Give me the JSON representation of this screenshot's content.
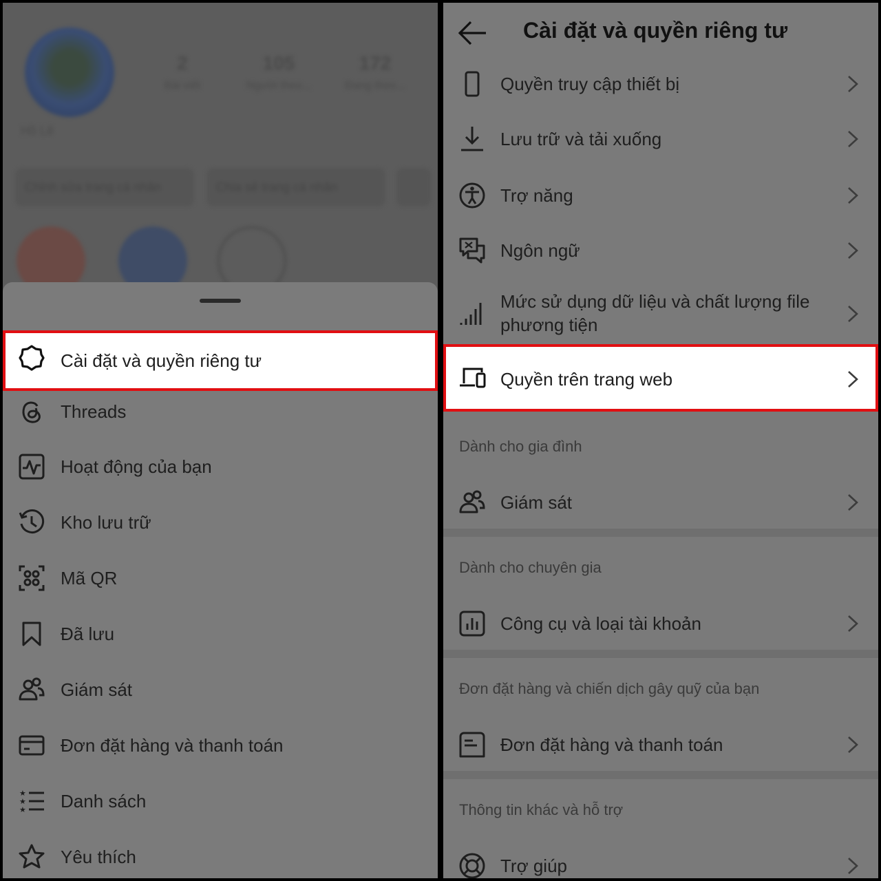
{
  "left_panel": {
    "profile_backdrop": {
      "stats": [
        {
          "num": "2",
          "label": "Bài viết"
        },
        {
          "num": "105",
          "label": "Người theo..."
        },
        {
          "num": "172",
          "label": "Đang theo..."
        }
      ],
      "name": "Hồ Lê",
      "buttons": [
        "Chỉnh sửa trang cá nhân",
        "Chia sẻ trang cá nhân"
      ]
    },
    "menu": [
      {
        "label": "Cài đặt và quyền riêng tư",
        "icon": "settings-gear-icon",
        "highlighted": true
      },
      {
        "label": "Threads",
        "icon": "threads-icon"
      },
      {
        "label": "Hoạt động của bạn",
        "icon": "activity-icon"
      },
      {
        "label": "Kho lưu trữ",
        "icon": "archive-history-icon"
      },
      {
        "label": "Mã QR",
        "icon": "qr-code-icon"
      },
      {
        "label": "Đã lưu",
        "icon": "bookmark-icon"
      },
      {
        "label": "Giám sát",
        "icon": "supervision-people-icon"
      },
      {
        "label": "Đơn đặt hàng và thanh toán",
        "icon": "card-icon"
      },
      {
        "label": "Danh sách",
        "icon": "list-icon"
      },
      {
        "label": "Yêu thích",
        "icon": "star-icon"
      }
    ]
  },
  "right_panel": {
    "title": "Cài đặt và quyền riêng tư",
    "items_top": [
      {
        "label": "Quyền truy cập thiết bị",
        "icon": "phone-icon"
      },
      {
        "label": "Lưu trữ và tải xuống",
        "icon": "download-icon"
      },
      {
        "label": "Trợ năng",
        "icon": "accessibility-icon"
      },
      {
        "label": "Ngôn ngữ",
        "icon": "language-icon"
      },
      {
        "label": "Mức sử dụng dữ liệu và chất lượng file phương tiện",
        "icon": "signal-bars-icon"
      },
      {
        "label": "Quyền trên trang web",
        "icon": "devices-icon",
        "highlighted": true
      }
    ],
    "sections": [
      {
        "header": "Dành cho gia đình",
        "items": [
          {
            "label": "Giám sát",
            "icon": "supervision-people-icon"
          }
        ]
      },
      {
        "header": "Dành cho chuyên gia",
        "items": [
          {
            "label": "Công cụ và loại tài khoản",
            "icon": "insights-chart-icon"
          }
        ]
      },
      {
        "header": "Đơn đặt hàng và chiến dịch gây quỹ của bạn",
        "items": [
          {
            "label": "Đơn đặt hàng và thanh toán",
            "icon": "receipt-icon"
          }
        ]
      },
      {
        "header": "Thông tin khác và hỗ trợ",
        "items": [
          {
            "label": "Trợ giúp",
            "icon": "lifebuoy-icon"
          }
        ]
      }
    ]
  },
  "colors": {
    "highlight_border": "#e10f12",
    "overlay_gray": "#7b7b7b"
  }
}
